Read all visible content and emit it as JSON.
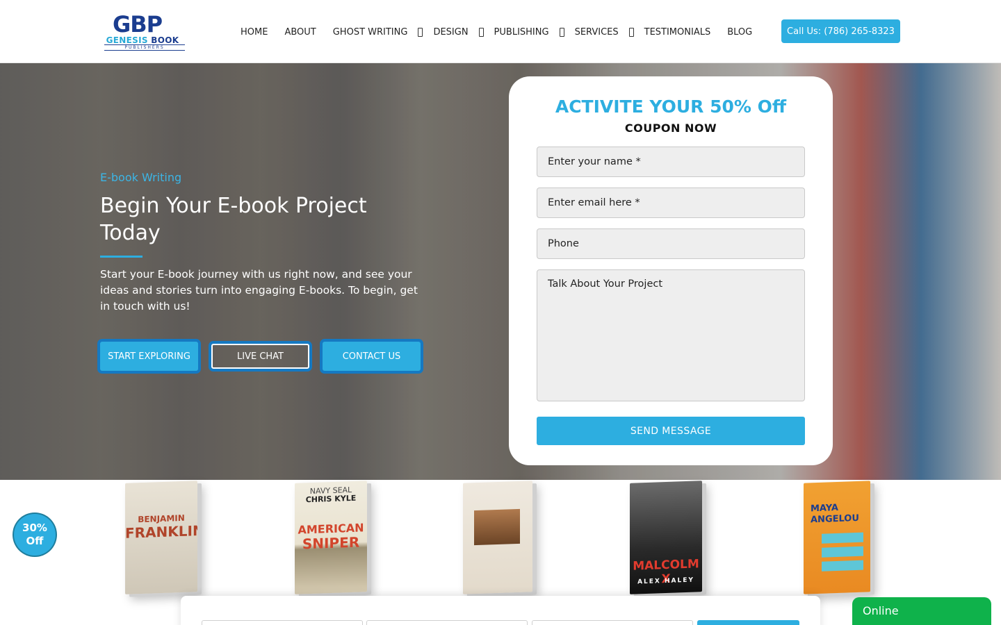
{
  "brand": {
    "logo_mark": "GBP",
    "logo_name_1": "GENESIS",
    "logo_name_2": "BOOK",
    "logo_sub": "PUBLISHERS"
  },
  "nav": {
    "home": "HOME",
    "about": "ABOUT",
    "ghost_writing": "GHOST WRITING",
    "design": "DESIGN",
    "publishing": "PUBLISHING",
    "services": "SERVICES",
    "testimonials": "TESTIMONIALS",
    "blog": "BLOG",
    "call": "Call Us: (786) 265-8323"
  },
  "hero": {
    "eyebrow": "E-book Writing",
    "title": "Begin Your E-book Project Today",
    "text": "Start your E-book journey with us right now, and see your ideas and stories turn into engaging E-books. To begin, get in touch with us!",
    "btn_explore": "START EXPLORING",
    "btn_chat": "LIVE CHAT",
    "btn_contact": "CONTACT US"
  },
  "form": {
    "title": "ACTIVITE YOUR 50% Off",
    "subtitle": "COUPON NOW",
    "name_placeholder": "Enter your name *",
    "email_placeholder": "Enter email here *",
    "phone_placeholder": "Phone",
    "project_placeholder": "Talk About Your Project",
    "submit": "SEND MESSAGE"
  },
  "books": {
    "b1_line1": "BENJAMIN",
    "b1_line2": "FRANKLIN",
    "b2_line1": "NAVY SEAL",
    "b2_line2": "CHRIS KYLE",
    "b2_line3": "AMERICAN",
    "b2_line4": "SNIPER",
    "b4_line1": "MALCOLM X",
    "b4_line2": "ALEX HALEY",
    "b5_line1": "MAYA",
    "b5_line2": "ANGELOU"
  },
  "discount": {
    "line1": "30%",
    "line2": "Off"
  },
  "chat": {
    "status": "Online"
  },
  "colors": {
    "accent": "#2daee0",
    "brand_navy": "#1b3d8f",
    "online_green": "#0fb24b"
  }
}
